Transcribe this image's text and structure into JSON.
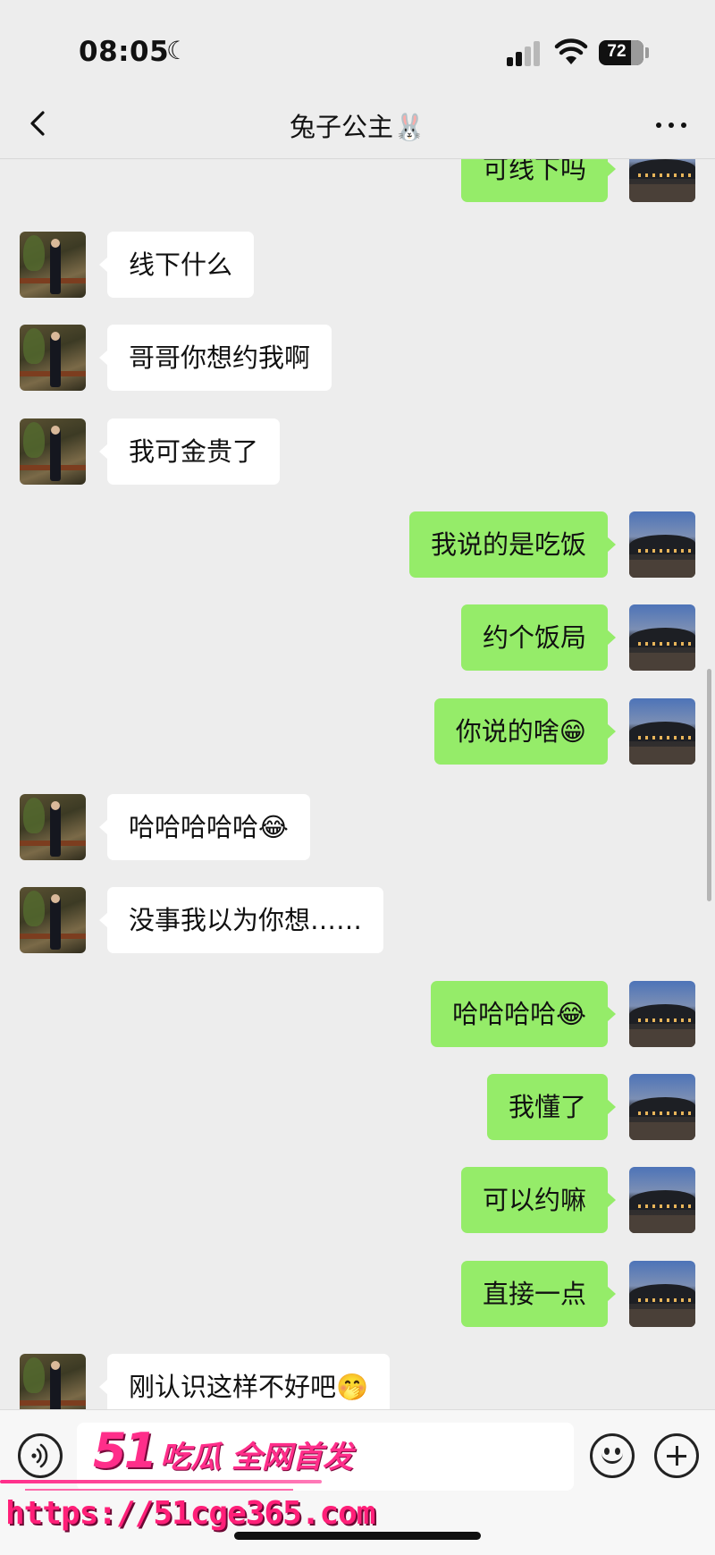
{
  "status_bar": {
    "time": "08:05",
    "moon_glyph": "☾",
    "battery": {
      "percent": "72",
      "level": 0.72
    },
    "signal_icon": "cellular-signal-icon",
    "wifi_icon": "wifi-icon"
  },
  "nav": {
    "title": "兔子公主🐰",
    "back_icon": "chevron-left-icon",
    "more_icon": "more-dots-icon"
  },
  "messages": [
    {
      "side": "out",
      "text": "可线下吗"
    },
    {
      "side": "in",
      "text": "线下什么"
    },
    {
      "side": "in",
      "text": "哥哥你想约我啊"
    },
    {
      "side": "in",
      "text": "我可金贵了"
    },
    {
      "side": "out",
      "text": "我说的是吃饭"
    },
    {
      "side": "out",
      "text": "约个饭局"
    },
    {
      "side": "out",
      "text": "你说的啥😁"
    },
    {
      "side": "in",
      "text": "哈哈哈哈哈😂"
    },
    {
      "side": "in",
      "text": "没事我以为你想……"
    },
    {
      "side": "out",
      "text": "哈哈哈哈😂"
    },
    {
      "side": "out",
      "text": "我懂了"
    },
    {
      "side": "out",
      "text": "可以约嘛"
    },
    {
      "side": "out",
      "text": "直接一点"
    },
    {
      "side": "in",
      "text": "刚认识这样不好吧🤭"
    }
  ],
  "input_bar": {
    "voice_icon": "voice-input-icon",
    "emoji_icon": "emoji-icon",
    "plus_icon": "plus-icon"
  },
  "watermark": {
    "brand": "51",
    "slogan": "吃瓜 全网首发",
    "url": "https://51cge365.com"
  },
  "colors": {
    "background": "#ededed",
    "bubble_out": "#95ec69",
    "bubble_in": "#ffffff",
    "watermark": "#ff2e8a"
  }
}
